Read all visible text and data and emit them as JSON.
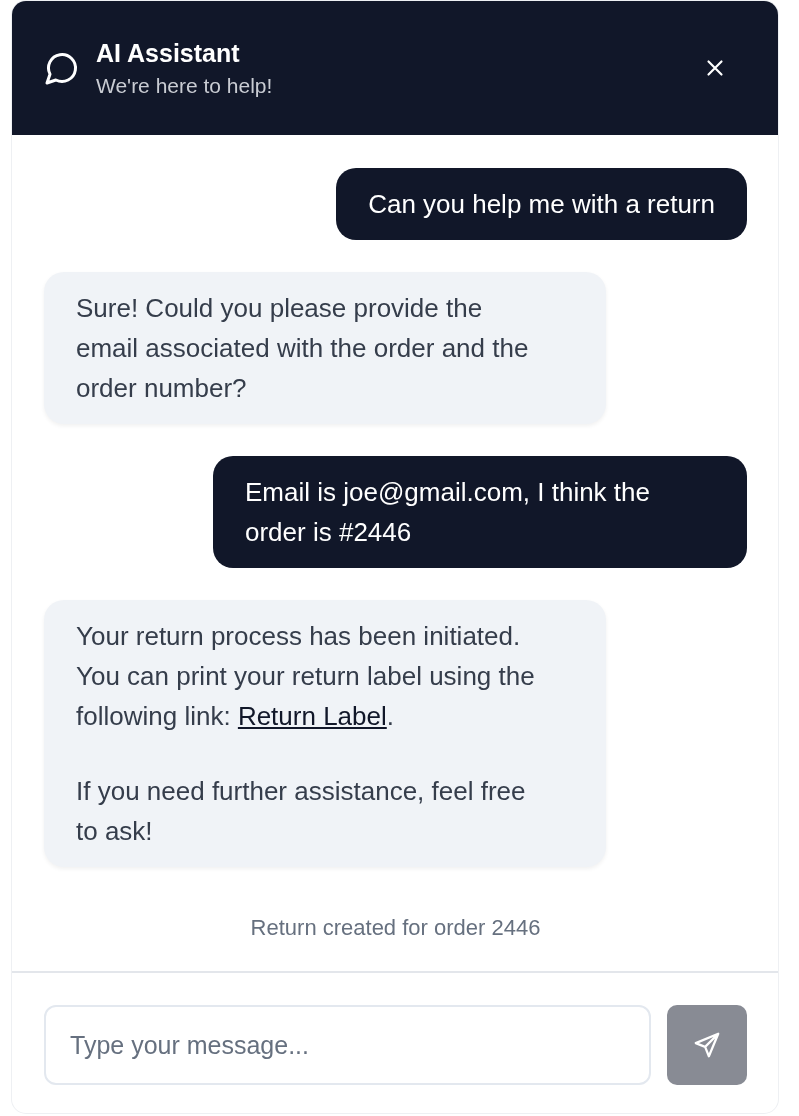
{
  "header": {
    "title": "AI Assistant",
    "subtitle": "We're here to help!"
  },
  "messages": [
    {
      "kind": "user",
      "paragraphs": [
        {
          "text": "Can you help me with a return"
        }
      ]
    },
    {
      "kind": "assistant",
      "paragraphs": [
        {
          "text": "Sure! Could you please provide the email associated with the order and the order number?"
        }
      ]
    },
    {
      "kind": "user",
      "paragraphs": [
        {
          "text": "Email is joe@gmail.com, I think the order is #2446"
        }
      ]
    },
    {
      "kind": "assistant",
      "paragraphs": [
        {
          "text": "Your return process has been initiated. You can print your return label using the following link:",
          "link": "Return Label",
          "after": "."
        },
        {
          "text": "If you need further assistance, feel free to ask!"
        }
      ]
    }
  ],
  "status_note": "Return created for order 2446",
  "composer": {
    "placeholder": "Type your message...",
    "send_disabled": true
  }
}
